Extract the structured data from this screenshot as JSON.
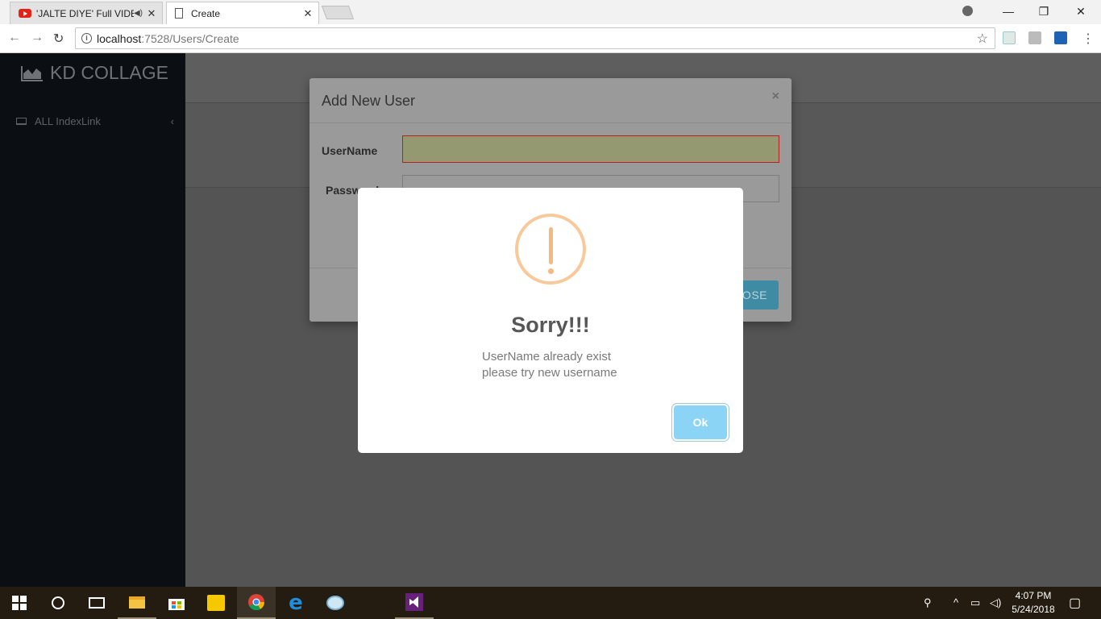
{
  "browser": {
    "tabs": [
      {
        "title": "'JALTE DIYE' Full VIDEO",
        "icon": "youtube-icon",
        "audio": true
      },
      {
        "title": "Create",
        "icon": "page-icon",
        "active": true
      }
    ],
    "url_host": "localhost",
    "url_path": ":7528/Users/Create"
  },
  "sidebar": {
    "brand": "KD COLLAGE",
    "items": [
      {
        "label": "ALL IndexLink"
      }
    ],
    "collapse_symbol": "<"
  },
  "modal": {
    "title": "Add New User",
    "close_symbol": "×",
    "username_label": "UserName",
    "password_label": "Password",
    "close_button": "CLOSE"
  },
  "alert": {
    "title": "Sorry!!!",
    "line1": "UserName already exist",
    "line2": "please try new username",
    "ok_label": "Ok",
    "icon": "warning-icon",
    "icon_color": "#f8c99a",
    "ok_color": "#8cd4f5"
  },
  "taskbar": {
    "time": "4:07 PM",
    "date": "5/24/2018"
  }
}
